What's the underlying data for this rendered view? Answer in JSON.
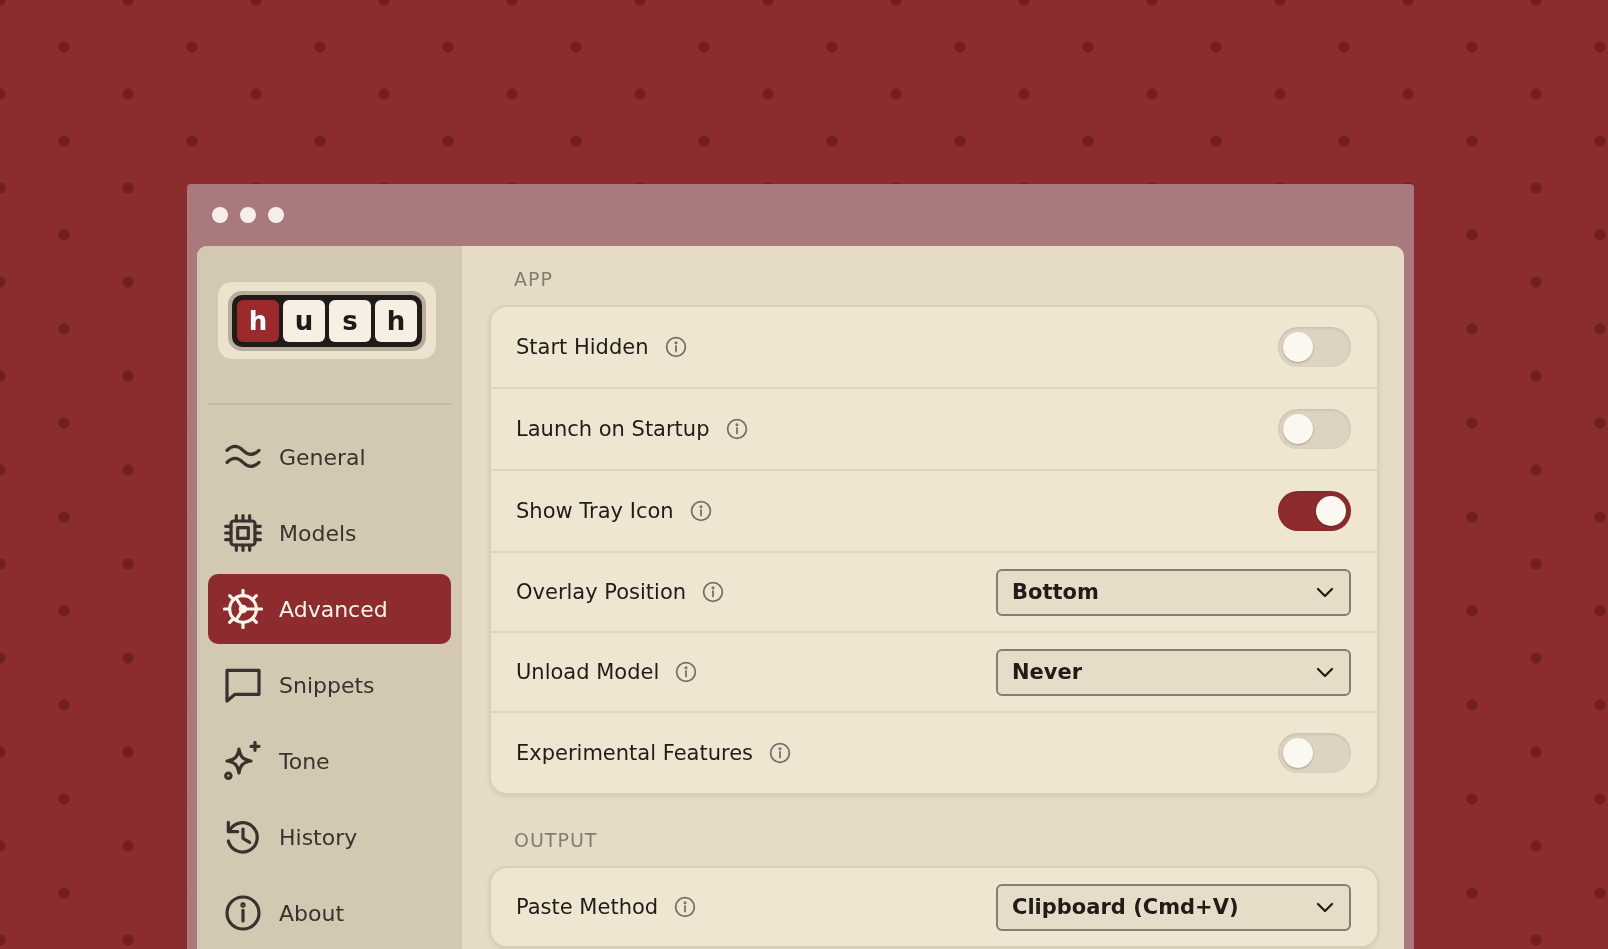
{
  "logo": {
    "letters": [
      {
        "char": "h",
        "accent": true
      },
      {
        "char": "u",
        "accent": false
      },
      {
        "char": "s",
        "accent": false
      },
      {
        "char": "h",
        "accent": false
      }
    ]
  },
  "sidebar": {
    "items": [
      {
        "label": "General",
        "selected": false
      },
      {
        "label": "Models",
        "selected": false
      },
      {
        "label": "Advanced",
        "selected": true
      },
      {
        "label": "Snippets",
        "selected": false
      },
      {
        "label": "Tone",
        "selected": false
      },
      {
        "label": "History",
        "selected": false
      },
      {
        "label": "About",
        "selected": false
      }
    ]
  },
  "sections": [
    {
      "title": "APP",
      "rows": [
        {
          "label": "Start Hidden",
          "kind": "toggle",
          "on": false
        },
        {
          "label": "Launch on Startup",
          "kind": "toggle",
          "on": false
        },
        {
          "label": "Show Tray Icon",
          "kind": "toggle",
          "on": true
        },
        {
          "label": "Overlay Position",
          "kind": "select",
          "value": "Bottom"
        },
        {
          "label": "Unload Model",
          "kind": "select",
          "value": "Never"
        },
        {
          "label": "Experimental Features",
          "kind": "toggle",
          "on": false
        }
      ]
    },
    {
      "title": "OUTPUT",
      "rows": [
        {
          "label": "Paste Method",
          "kind": "select",
          "value": "Clipboard (Cmd+V)"
        }
      ]
    }
  ]
}
